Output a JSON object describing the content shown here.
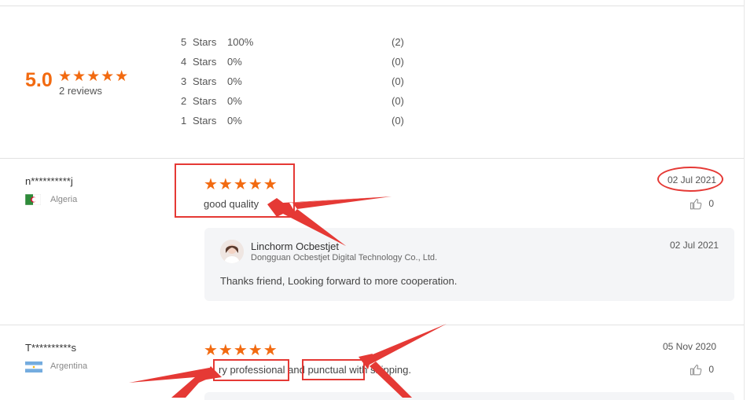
{
  "summary": {
    "score": "5.0",
    "stars": "★★★★★",
    "reviews_label": "2 reviews"
  },
  "histogram": [
    {
      "label": "5",
      "unit": "Stars",
      "percent": "100%",
      "count": "(2)"
    },
    {
      "label": "4",
      "unit": "Stars",
      "percent": "0%",
      "count": "(0)"
    },
    {
      "label": "3",
      "unit": "Stars",
      "percent": "0%",
      "count": "(0)"
    },
    {
      "label": "2",
      "unit": "Stars",
      "percent": "0%",
      "count": "(0)"
    },
    {
      "label": "1",
      "unit": "Stars",
      "percent": "0%",
      "count": "(0)"
    }
  ],
  "reviews": [
    {
      "user": "n**********j",
      "country": "Algeria",
      "stars": "★★★★★",
      "text": "good quality",
      "date": "02 Jul 2021",
      "likes": "0",
      "reply": {
        "name": "Linchorm Ocbestjet",
        "company": "Dongguan Ocbestjet Digital Technology Co., Ltd.",
        "date": "02 Jul 2021",
        "text": "Thanks friend, Looking forward to more cooperation."
      }
    },
    {
      "user": "T**********s",
      "country": "Argentina",
      "stars": "★★★★★",
      "text": "ry professional and punctual with shipping.",
      "date": "05 Nov 2020",
      "likes": "0"
    }
  ],
  "colors": {
    "accent": "#f26a10",
    "annotation": "#e53935"
  },
  "icons": {
    "like": "thumbs-up-icon",
    "flag_algeria": "flag-algeria-icon",
    "flag_argentina": "flag-argentina-icon"
  }
}
